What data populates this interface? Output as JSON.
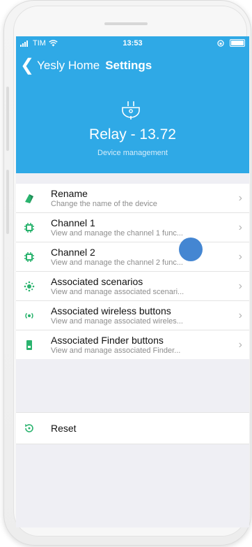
{
  "status_bar": {
    "carrier": "TIM",
    "time": "13:53"
  },
  "nav": {
    "back_label": "Yesly Home",
    "title": "Settings"
  },
  "device": {
    "name": "Relay - 13.72",
    "subtitle": "Device management",
    "icon": "plug-icon"
  },
  "menu": [
    {
      "title": "Rename",
      "subtitle": "Change the name of the device",
      "icon": "tag-icon",
      "color": "#2ab36e"
    },
    {
      "title": "Channel 1",
      "subtitle": "View and manage the channel 1 func...",
      "icon": "chip-icon",
      "color": "#2ab36e"
    },
    {
      "title": "Channel 2",
      "subtitle": "View and manage the channel 2 func...",
      "icon": "chip-icon",
      "color": "#2ab36e"
    },
    {
      "title": "Associated scenarios",
      "subtitle": "View and manage associated scenari...",
      "icon": "scenario-icon",
      "color": "#2ab36e"
    },
    {
      "title": "Associated wireless buttons",
      "subtitle": "View and manage associated wireles...",
      "icon": "wireless-icon",
      "color": "#2ab36e"
    },
    {
      "title": "Associated Finder buttons",
      "subtitle": "View and manage associated Finder...",
      "icon": "finder-button-icon",
      "color": "#2ab36e"
    }
  ],
  "reset": {
    "label": "Reset",
    "icon": "reset-icon"
  },
  "colors": {
    "header": "#2fa9e6",
    "accent": "#2ab36e",
    "background": "#efeff4"
  }
}
